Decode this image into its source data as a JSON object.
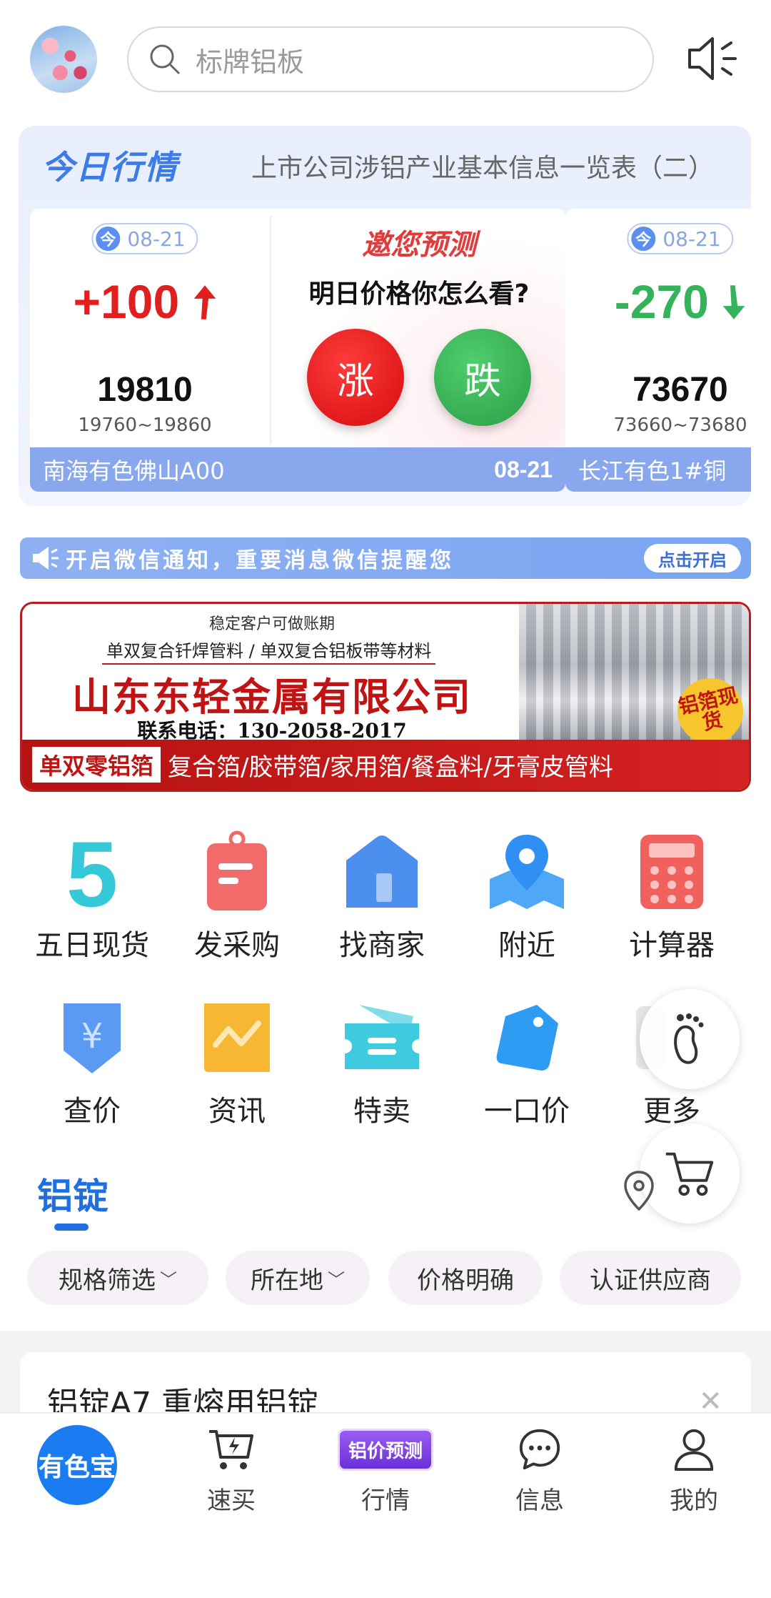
{
  "header": {
    "search_placeholder": "标牌铝板"
  },
  "market": {
    "tag": "今日行情",
    "headline": "上市公司涉铝产业基本信息一览表（二）",
    "items": [
      {
        "date": "08-21",
        "change": "+100",
        "direction": "up",
        "price": "19810",
        "range": "19760~19860",
        "source": "南海有色佛山A00",
        "footer_date": "08-21"
      },
      {
        "date": "08-21",
        "change": "-270",
        "direction": "down",
        "price": "73670",
        "range": "73660~73680",
        "source": "长江有色1#铜"
      }
    ],
    "poll": {
      "title": "邀您预测",
      "question": "明日价格你怎么看?",
      "up_label": "涨",
      "down_label": "跌"
    },
    "today_badge": "今"
  },
  "wechat": {
    "text": "开启微信通知，重要消息微信提醒您",
    "button": "点击开启"
  },
  "ad": {
    "line1": "稳定客户可做账期",
    "line2": "单双复合钎焊管料 / 单双复合铝板带等材料",
    "company": "山东东轻金属有限公司",
    "phone": "联系电话：130-2058-2017",
    "stamp": "铝箔现货",
    "bar_tag": "单双零铝箔",
    "bar_text": "复合箔/胶带箔/家用箔/餐盒料/牙膏皮管料"
  },
  "grid": [
    {
      "label": "五日现货",
      "icon": "five-icon"
    },
    {
      "label": "发采购",
      "icon": "clipboard-icon"
    },
    {
      "label": "找商家",
      "icon": "store-icon"
    },
    {
      "label": "附近",
      "icon": "map-pin-icon"
    },
    {
      "label": "计算器",
      "icon": "calculator-icon"
    },
    {
      "label": "查价",
      "icon": "yen-shield-icon"
    },
    {
      "label": "资讯",
      "icon": "news-icon"
    },
    {
      "label": "特卖",
      "icon": "ticket-icon"
    },
    {
      "label": "一口价",
      "icon": "price-tag-icon"
    },
    {
      "label": "更多",
      "icon": "more-icon"
    }
  ],
  "section": {
    "title": "铝锭",
    "filters": [
      {
        "label": "规格筛选",
        "chevron": true
      },
      {
        "label": "所在地",
        "chevron": true
      },
      {
        "label": "价格明确",
        "chevron": false
      },
      {
        "label": "认证供应商",
        "chevron": false
      }
    ],
    "product_title": "铝锭A7 重熔用铝锭"
  },
  "nav": {
    "home": "有色宝",
    "items": [
      {
        "label": "速买"
      },
      {
        "label": "行情",
        "promo": "铝价预测"
      },
      {
        "label": "信息"
      },
      {
        "label": "我的"
      }
    ]
  },
  "colors": {
    "primary": "#1f6fe0",
    "up": "#e02020",
    "down": "#35b35b",
    "footer_bar": "#89a7ec"
  }
}
